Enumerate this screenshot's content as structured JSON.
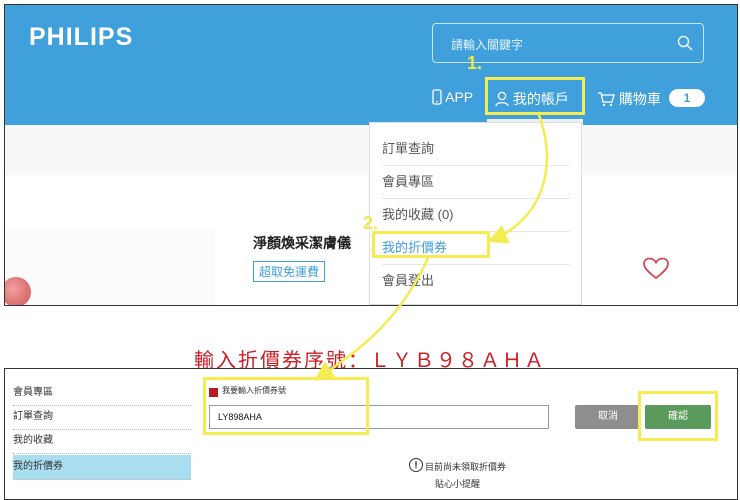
{
  "header": {
    "logo": "PHILIPS",
    "search_placeholder": "請輸入關鍵字",
    "nav": {
      "app": "APP",
      "account": "我的帳戶",
      "cart": "購物車",
      "cart_count": "1"
    }
  },
  "dropdown": {
    "items": [
      "訂單查詢",
      "會員專區",
      "我的收藏 (0)",
      "我的折價券",
      "會員登出"
    ]
  },
  "product": {
    "title": "淨顏煥采潔膚儀",
    "free_shipping": "超取免運費"
  },
  "annotations": {
    "step1": "1.",
    "step2": "2.",
    "instruction": "輸入折價券序號：ＬＹＢ９８ＡＨＡ"
  },
  "bottom": {
    "sidebar": [
      "會員專區",
      "訂單查詢",
      "我的收藏",
      "我的折價券"
    ],
    "checkbox_label": "我要輸入折價券號",
    "coupon_code": "LY898AHA",
    "cancel": "取消",
    "confirm": "確認",
    "notice": "目前尚未領取折價券",
    "tip": "貼心小提醒"
  },
  "colors": {
    "brand_blue": "#3fa0dc",
    "highlight_yellow": "#f5ec52",
    "instruction_red": "#cc1f25",
    "confirm_green": "#5a9a5a"
  }
}
